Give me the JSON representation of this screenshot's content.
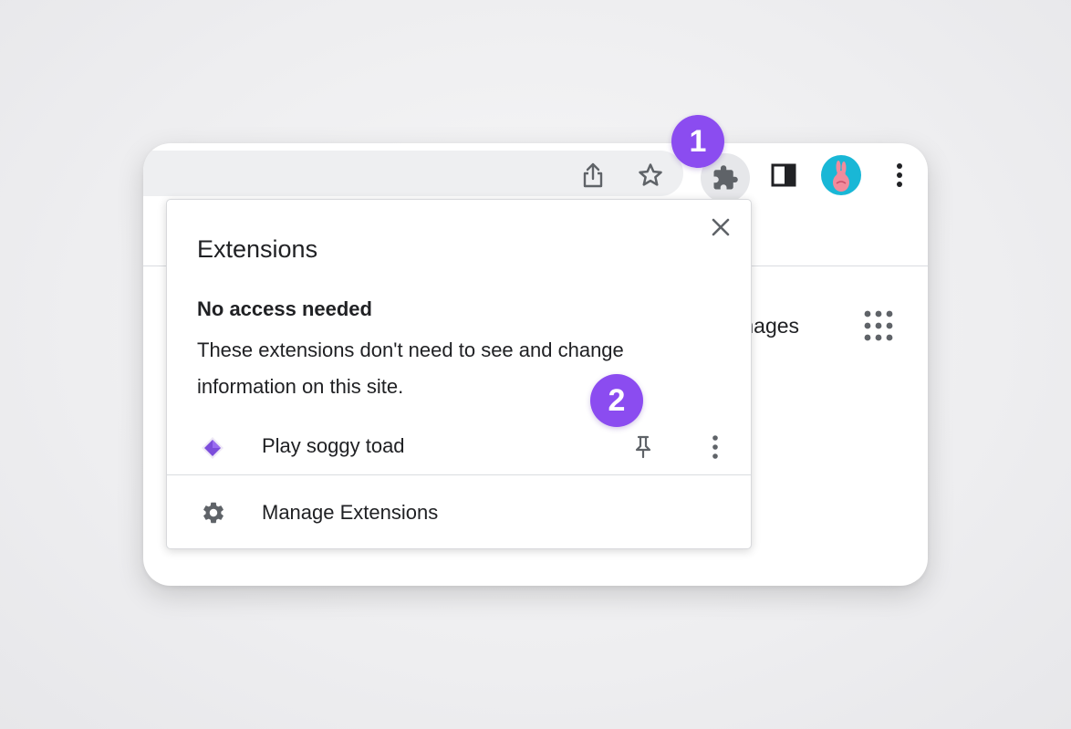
{
  "toolbar": {
    "icons": [
      "share-icon",
      "bookmark-star-icon",
      "extensions-puzzle-icon",
      "side-panel-icon",
      "profile-avatar",
      "kebab-menu-icon"
    ]
  },
  "page": {
    "images_link": "mages",
    "apps_icon": "apps-grid-icon"
  },
  "popup": {
    "title": "Extensions",
    "section_heading": "No access needed",
    "section_description": "These extensions don't need to see and change information on this site.",
    "extensions": [
      {
        "name": "Play soggy toad",
        "icon": "purple-diamond-icon"
      }
    ],
    "manage_label": "Manage Extensions"
  },
  "annotations": {
    "badge_1": "1",
    "badge_2": "2",
    "color": "#8b4cf0"
  },
  "colors": {
    "text": "#202124",
    "icon": "#5f6368",
    "avatar_bg": "#19b7d6"
  }
}
